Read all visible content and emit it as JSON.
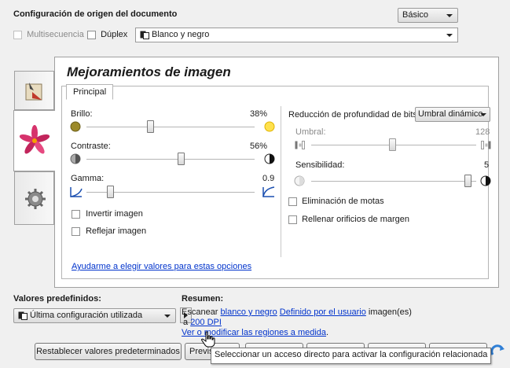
{
  "source": {
    "title": "Configuración de origen del documento",
    "mode_value": "Básico",
    "multiseq_label": "Multisecuencia",
    "duplex_label": "Dúplex",
    "color_value": "Blanco y negro"
  },
  "panel": {
    "heading": "Mejoramientos de imagen",
    "tab_main": "Principal",
    "brightness_label": "Brillo:",
    "brightness_value": "38%",
    "brightness_level": 38,
    "contrast_label": "Contraste:",
    "contrast_value": "56%",
    "contrast_level": 56,
    "gamma_label": "Gamma:",
    "gamma_value": "0.9",
    "invert_label": "Invertir imagen",
    "mirror_label": "Reflejar imagen",
    "help_link": "Ayudarme a elegir valores para estas opciones",
    "bitdepth_label": "Reducción de profundidad de bits:",
    "bitdepth_value": "Umbral dinámico",
    "threshold_label": "Umbral:",
    "threshold_value": "128",
    "sensitivity_label": "Sensibilidad:",
    "sensitivity_value": "5",
    "despeckle_label": "Eliminación de motas",
    "holefill_label": "Rellenar orificios de margen"
  },
  "presets": {
    "title": "Valores predefinidos:",
    "value": "Última configuración utilizada"
  },
  "summary": {
    "title": "Resumen:",
    "line1_prefix": "Escanear",
    "link_color": "blanco y negro",
    "link_user": "Definido por el usuario",
    "line1_suffix": "imagen(es)",
    "line2_prefix": "a",
    "link_dpi": "200 DPI",
    "link_regions": "Ver o modificar las regiones a medida",
    "period": "."
  },
  "buttons": {
    "reset": "Restablecer valores predeterminados",
    "preview": "Previs"
  },
  "tooltip": "Seleccionar un acceso directo para activar la configuración relacionada",
  "colors": {
    "accent_link": "#0033cc",
    "tooltip_bg": "#ffffff",
    "gamma_blue": "#1a4fb0"
  }
}
